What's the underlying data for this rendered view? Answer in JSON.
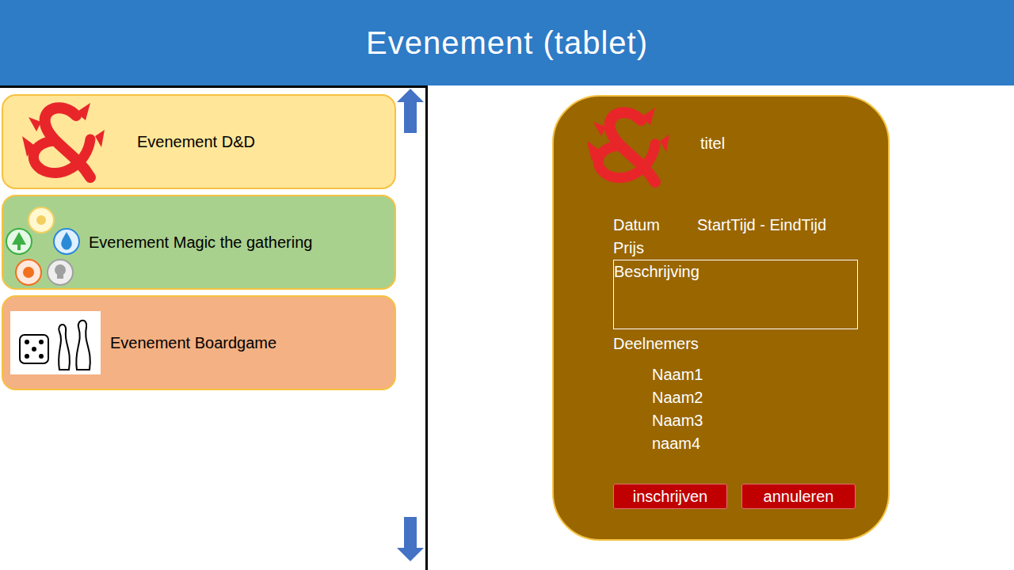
{
  "header": {
    "title": "Evenement (tablet)"
  },
  "events": [
    {
      "label": "Evenement D&D",
      "kind": "dnd",
      "color": "#ffe699"
    },
    {
      "label": "Evenement Magic the gathering",
      "kind": "mtg",
      "color": "#a9d18e"
    },
    {
      "label": "Evenement Boardgame",
      "kind": "boardgame",
      "color": "#f4b183"
    }
  ],
  "detail": {
    "title": "titel",
    "date": "Datum",
    "time": "StartTijd - EindTijd",
    "price": "Prijs",
    "description": "Beschrijving",
    "participants_label": "Deelnemers",
    "participants": [
      "Naam1",
      "Naam2",
      "Naam3",
      "naam4"
    ],
    "buttons": [
      "inschrijven",
      "annuleren"
    ]
  }
}
